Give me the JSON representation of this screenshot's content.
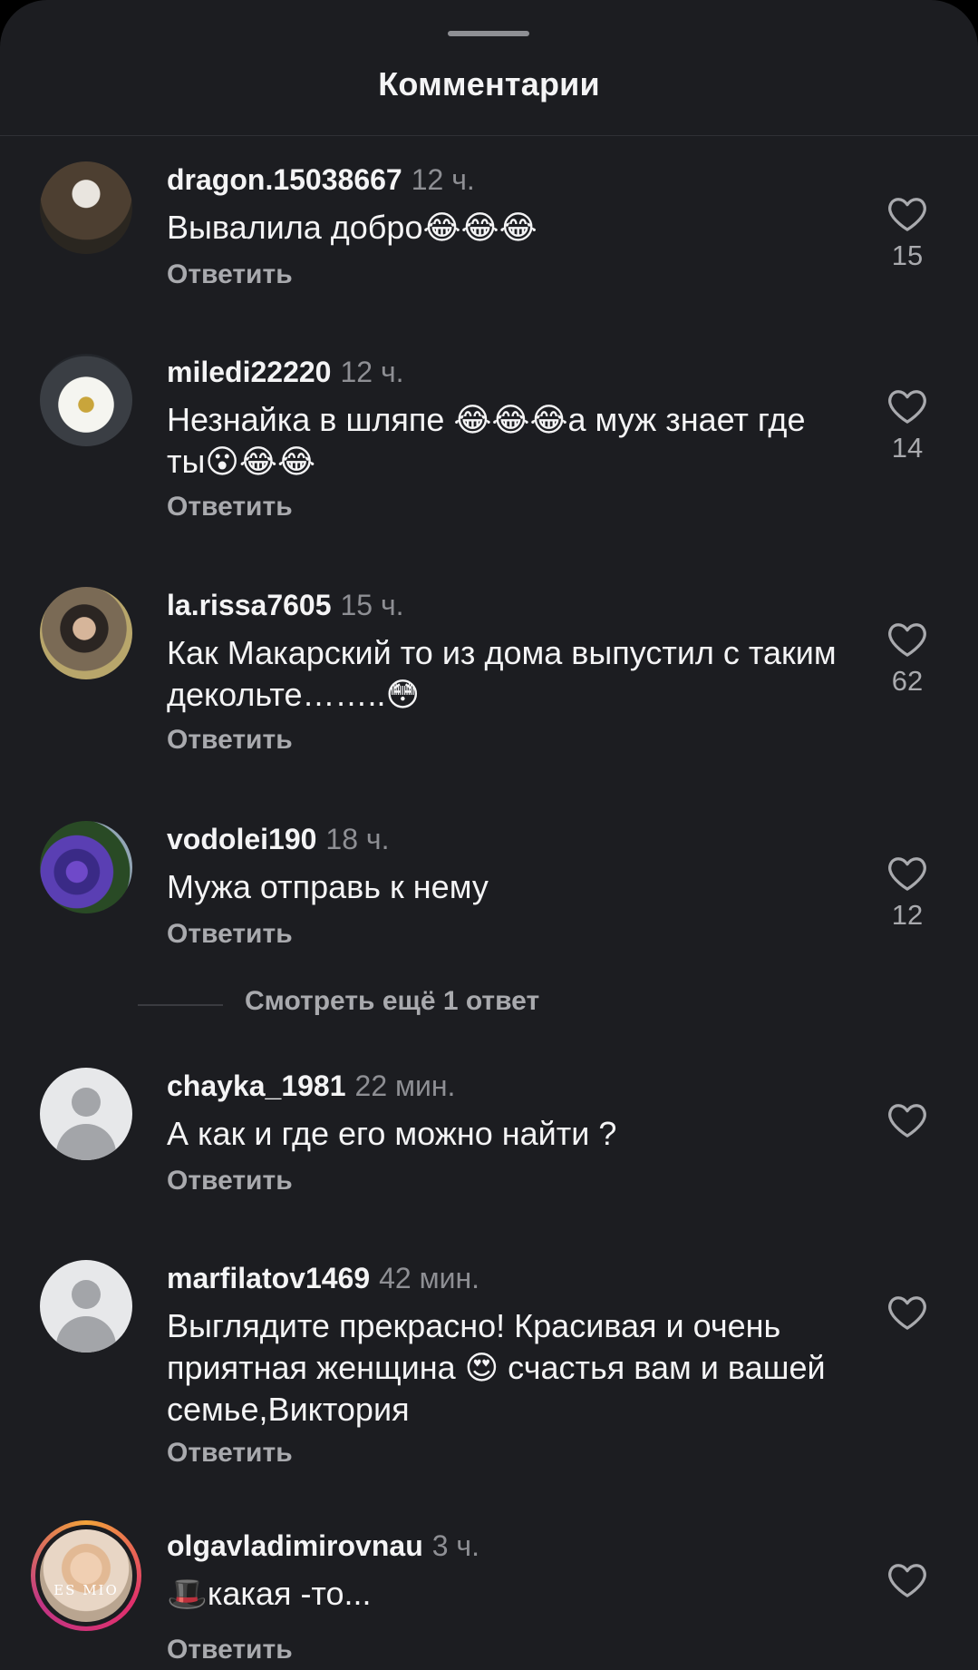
{
  "sheet": {
    "title": "Комментарии"
  },
  "reply_label": "Ответить",
  "comments": [
    {
      "username": "dragon.15038667",
      "time": "12 ч.",
      "text": "Вывалила добро😂😂😂",
      "likes": "15"
    },
    {
      "username": "miledi22220",
      "time": "12 ч.",
      "text": "Незнайка в шляпе 😂😂😂а муж знает где ты😮😂😂",
      "likes": "14"
    },
    {
      "username": "la.rissa7605",
      "time": "15 ч.",
      "text": "Как Макарский то из дома выпустил с таким декольте……..😳",
      "likes": "62"
    },
    {
      "username": "vodolei190",
      "time": "18 ч.",
      "text": "Мужа отправь к нему",
      "likes": "12"
    },
    {
      "username": "chayka_1981",
      "time": "22 мин.",
      "text": "А как и где его можно найти ?"
    },
    {
      "username": "marfilatov1469",
      "time": "42 мин.",
      "text": "Выглядите прекрасно! Красивая и очень приятная женщина 😍 счастья вам и вашей семье,Виктория"
    },
    {
      "username": "olgavladimirovnau",
      "time": "3 ч.",
      "text": "🎩какая -то..."
    }
  ],
  "view_more_replies": "Смотреть ещё 1 ответ",
  "avatar_watermark": "ES MIO",
  "colors": {
    "background": "#1c1d21",
    "text": "#f4f4f5",
    "secondary": "#8e8f94",
    "reply": "#a9aaae"
  },
  "icons": {
    "like": "heart-outline-icon",
    "default_avatar": "person-placeholder-icon"
  }
}
